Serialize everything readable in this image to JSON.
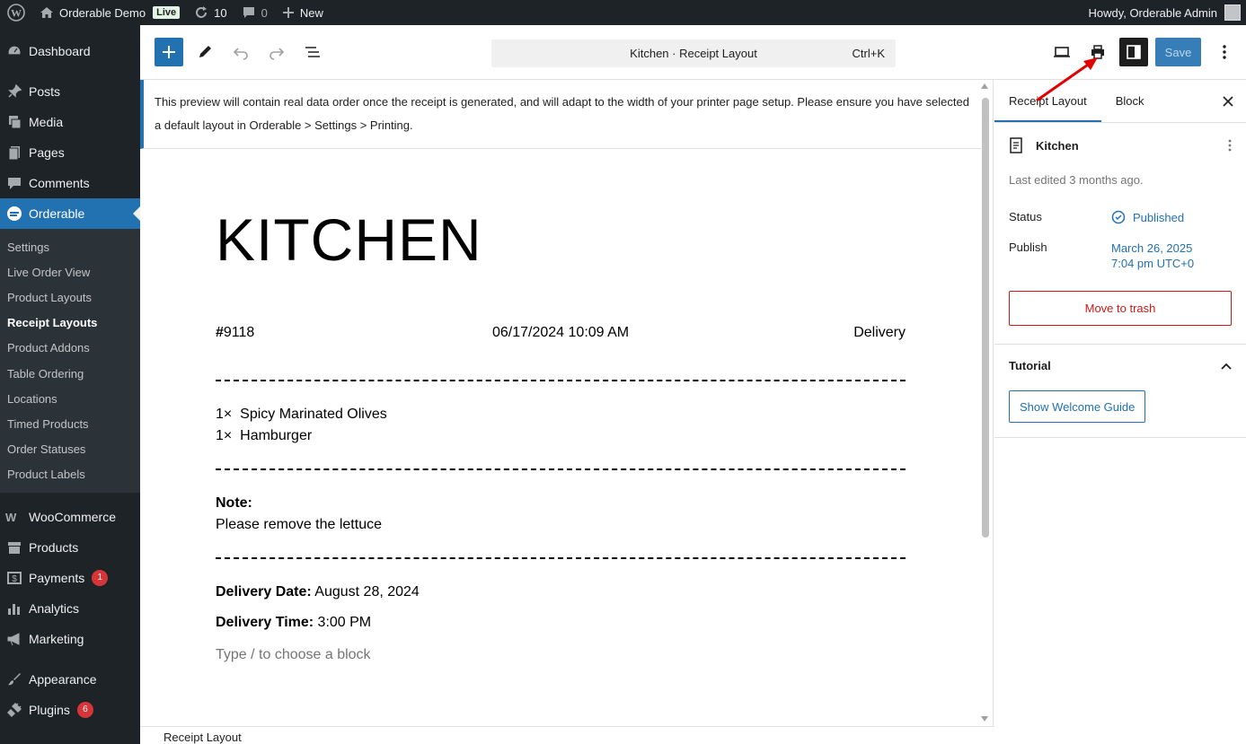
{
  "admin_bar": {
    "site_name": "Orderable Demo",
    "live_badge": "Live",
    "updates_count": "10",
    "comments_count": "0",
    "new_label": "New",
    "greeting": "Howdy, Orderable Admin"
  },
  "sidebar": {
    "items": [
      {
        "label": "Dashboard",
        "icon": "dashboard-icon"
      },
      {
        "label": "Posts",
        "icon": "pin-icon"
      },
      {
        "label": "Media",
        "icon": "media-icon"
      },
      {
        "label": "Pages",
        "icon": "pages-icon"
      },
      {
        "label": "Comments",
        "icon": "comments-icon"
      },
      {
        "label": "Orderable",
        "icon": "orderable-icon"
      }
    ],
    "submenu": [
      "Settings",
      "Live Order View",
      "Product Layouts",
      "Receipt Layouts",
      "Product Addons",
      "Table Ordering",
      "Locations",
      "Timed Products",
      "Order Statuses",
      "Product Labels"
    ],
    "items_after": [
      {
        "label": "WooCommerce",
        "icon": "woocommerce-icon"
      },
      {
        "label": "Products",
        "icon": "products-icon"
      },
      {
        "label": "Payments",
        "icon": "payments-icon",
        "badge": "1"
      },
      {
        "label": "Analytics",
        "icon": "analytics-icon"
      },
      {
        "label": "Marketing",
        "icon": "marketing-icon"
      },
      {
        "label": "Appearance",
        "icon": "appearance-icon"
      },
      {
        "label": "Plugins",
        "icon": "plugins-icon",
        "badge": "6"
      }
    ]
  },
  "header": {
    "doc_title": "Kitchen · Receipt Layout",
    "shortcut": "Ctrl+K",
    "save_label": "Save"
  },
  "notice": {
    "text": "This preview will contain real data order once the receipt is generated, and will adapt to the width of your printer page setup. Please ensure you have selected a default layout in Orderable > Settings > Printing."
  },
  "receipt": {
    "title": "KITCHEN",
    "order_number_prefix": "#",
    "order_number": "9118",
    "datetime": "06/17/2024 10:09 AM",
    "order_type": "Delivery",
    "items": [
      {
        "qty": "1×",
        "name": "Spicy Marinated Olives"
      },
      {
        "qty": "1×",
        "name": "Hamburger"
      }
    ],
    "note_label": "Note:",
    "note_text": "Please remove the lettuce",
    "delivery_date_label": "Delivery Date:",
    "delivery_date": "August 28, 2024",
    "delivery_time_label": "Delivery Time:",
    "delivery_time": "3:00 PM",
    "placeholder": "Type / to choose a block"
  },
  "footer": {
    "breadcrumb": "Receipt Layout"
  },
  "panel": {
    "tab_receipt": "Receipt Layout",
    "tab_block": "Block",
    "doc_name": "Kitchen",
    "last_edited": "Last edited 3 months ago.",
    "status_label": "Status",
    "status_value": "Published",
    "publish_label": "Publish",
    "publish_date": "March 26, 2025",
    "publish_time": "7:04 pm UTC+0",
    "trash_label": "Move to trash",
    "tutorial_label": "Tutorial",
    "guide_label": "Show Welcome Guide"
  },
  "colors": {
    "accent": "#2271b1",
    "admin_dark": "#1d2327",
    "danger": "#cc1818",
    "annotation_arrow": "#e00000"
  }
}
